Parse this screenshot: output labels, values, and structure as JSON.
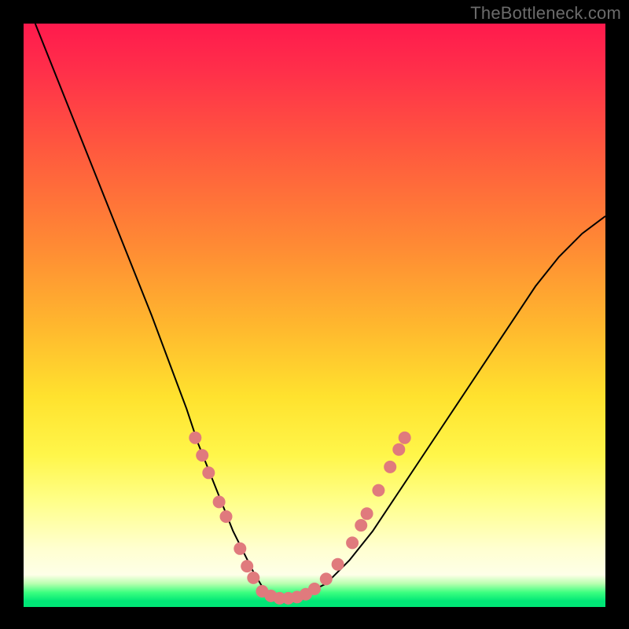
{
  "watermark": "TheBottleneck.com",
  "colors": {
    "dot": "#e07a7d",
    "curve": "#000000",
    "frame": "#000000"
  },
  "chart_data": {
    "type": "line",
    "title": "",
    "xlabel": "",
    "ylabel": "",
    "xlim": [
      0,
      100
    ],
    "ylim": [
      0,
      100
    ],
    "grid": false,
    "legend": false,
    "series": [
      {
        "name": "bottleneck-curve",
        "x": [
          2,
          6,
          10,
          14,
          18,
          22,
          25,
          28,
          30,
          32,
          34,
          36,
          38,
          39.5,
          41,
          43,
          45,
          48,
          52,
          56,
          60,
          64,
          68,
          72,
          76,
          80,
          84,
          88,
          92,
          96,
          100
        ],
        "y": [
          100,
          90,
          80,
          70,
          60,
          50,
          42,
          34,
          28,
          23,
          18,
          13,
          9,
          6,
          3.5,
          2,
          1.5,
          2,
          4,
          8,
          13,
          19,
          25,
          31,
          37,
          43,
          49,
          55,
          60,
          64,
          67
        ]
      }
    ],
    "markers": [
      {
        "x": 29.5,
        "y": 29
      },
      {
        "x": 30.7,
        "y": 26
      },
      {
        "x": 31.8,
        "y": 23
      },
      {
        "x": 33.6,
        "y": 18
      },
      {
        "x": 34.8,
        "y": 15.5
      },
      {
        "x": 37.2,
        "y": 10
      },
      {
        "x": 38.4,
        "y": 7
      },
      {
        "x": 39.5,
        "y": 5
      },
      {
        "x": 41,
        "y": 2.7
      },
      {
        "x": 42.5,
        "y": 1.9
      },
      {
        "x": 44,
        "y": 1.5
      },
      {
        "x": 45.5,
        "y": 1.5
      },
      {
        "x": 47,
        "y": 1.7
      },
      {
        "x": 48.5,
        "y": 2.2
      },
      {
        "x": 50,
        "y": 3.1
      },
      {
        "x": 52,
        "y": 4.8
      },
      {
        "x": 54,
        "y": 7.3
      },
      {
        "x": 56.5,
        "y": 11
      },
      {
        "x": 58,
        "y": 14
      },
      {
        "x": 59,
        "y": 16
      },
      {
        "x": 61,
        "y": 20
      },
      {
        "x": 63,
        "y": 24
      },
      {
        "x": 64.5,
        "y": 27
      },
      {
        "x": 65.5,
        "y": 29
      }
    ]
  }
}
